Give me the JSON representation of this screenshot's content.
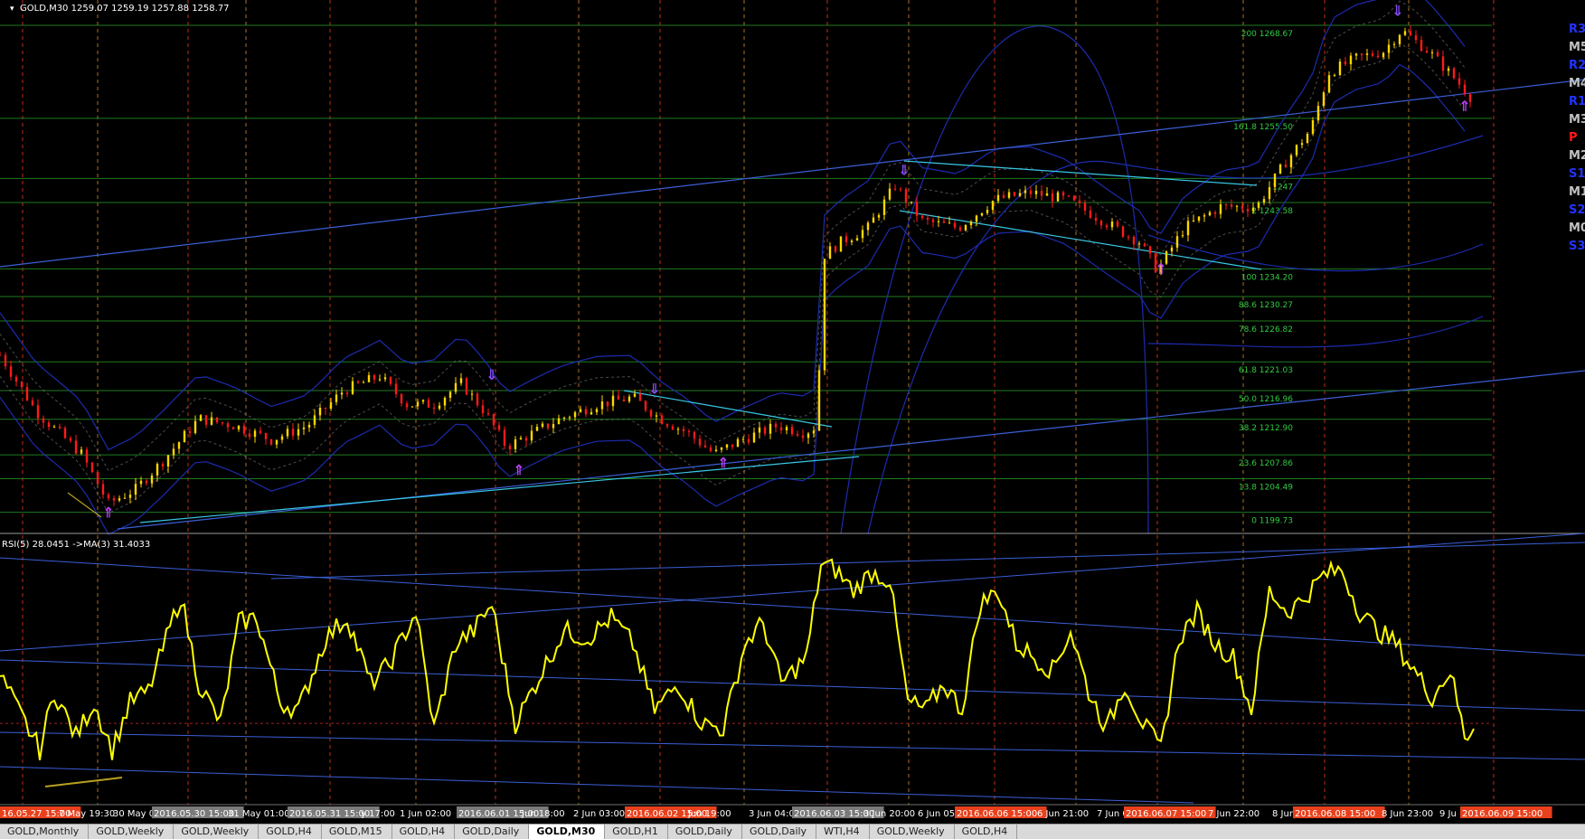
{
  "window": {
    "symbol_header": "GOLD,M30  1259.07 1259.19 1257.88 1258.77",
    "rsi_header": "RSI(5) 28.0451  ->MA(3) 31.4033"
  },
  "colors": {
    "background": "#000000",
    "bull": "#ffd700",
    "bear": "#ff1a1a",
    "rsi_line": "#ffff00",
    "fib_line": "#1f7a1f",
    "fib_text": "#2ecc40",
    "trendline_blue": "#3a5fd6",
    "trendline_cyan": "#38c8e6",
    "bands": "#2030c0",
    "session_sep": "#c03010",
    "day_sep": "#b07020"
  },
  "pivot_labels": [
    {
      "text": "R3",
      "color": "#2233ff"
    },
    {
      "text": "M5",
      "color": "#c0c0c0"
    },
    {
      "text": "R2",
      "color": "#2233ff"
    },
    {
      "text": "M4",
      "color": "#c0c0c0"
    },
    {
      "text": "R1",
      "color": "#2233ff"
    },
    {
      "text": "M3",
      "color": "#c0c0c0"
    },
    {
      "text": "P",
      "color": "#ff1a1a"
    },
    {
      "text": "M2",
      "color": "#c0c0c0"
    },
    {
      "text": "S1",
      "color": "#2233ff"
    },
    {
      "text": "M1",
      "color": "#c0c0c0"
    },
    {
      "text": "S2",
      "color": "#2233ff"
    },
    {
      "text": "M0",
      "color": "#c0c0c0"
    },
    {
      "text": "S3",
      "color": "#2233ff"
    }
  ],
  "chart_data": {
    "type": "line",
    "title": "GOLD,M30",
    "price_axis_range": [
      1197,
      1272
    ],
    "fibonacci_levels": [
      {
        "label": "200 1268.67",
        "price": 1268.67
      },
      {
        "label": "161.8 1255.50",
        "price": 1255.5
      },
      {
        "label": "1247",
        "price": 1247.0
      },
      {
        "label": "2 1243.58",
        "price": 1243.58
      },
      {
        "label": "100 1234.20",
        "price": 1234.2
      },
      {
        "label": "88.6 1230.27",
        "price": 1230.27
      },
      {
        "label": "78.6 1226.82",
        "price": 1226.82
      },
      {
        "label": "61.8 1221.03",
        "price": 1221.03
      },
      {
        "label": "50.0 1216.96",
        "price": 1216.96
      },
      {
        "label": "38.2 1212.90",
        "price": 1212.9
      },
      {
        "label": "23.6 1207.86",
        "price": 1207.86
      },
      {
        "label": "13.8 1204.49",
        "price": 1204.49
      },
      {
        "label": "0 1199.73",
        "price": 1199.73
      }
    ],
    "price_series": [
      {
        "bar": 0,
        "price": 1222
      },
      {
        "bar": 20,
        "price": 1214
      },
      {
        "bar": 45,
        "price": 1208
      },
      {
        "bar": 60,
        "price": 1201
      },
      {
        "bar": 75,
        "price": 1203
      },
      {
        "bar": 90,
        "price": 1207
      },
      {
        "bar": 110,
        "price": 1213
      },
      {
        "bar": 130,
        "price": 1212
      },
      {
        "bar": 150,
        "price": 1210
      },
      {
        "bar": 170,
        "price": 1212
      },
      {
        "bar": 190,
        "price": 1217
      },
      {
        "bar": 210,
        "price": 1219
      },
      {
        "bar": 225,
        "price": 1215
      },
      {
        "bar": 240,
        "price": 1215
      },
      {
        "bar": 255,
        "price": 1218
      },
      {
        "bar": 268,
        "price": 1214
      },
      {
        "bar": 280,
        "price": 1209
      },
      {
        "bar": 295,
        "price": 1211
      },
      {
        "bar": 310,
        "price": 1213
      },
      {
        "bar": 330,
        "price": 1215
      },
      {
        "bar": 350,
        "price": 1216
      },
      {
        "bar": 365,
        "price": 1213
      },
      {
        "bar": 380,
        "price": 1211
      },
      {
        "bar": 395,
        "price": 1208
      },
      {
        "bar": 410,
        "price": 1210
      },
      {
        "bar": 430,
        "price": 1212
      },
      {
        "bar": 445,
        "price": 1211
      },
      {
        "bar": 452,
        "price": 1212
      },
      {
        "bar": 455,
        "price": 1236
      },
      {
        "bar": 465,
        "price": 1238
      },
      {
        "bar": 480,
        "price": 1240
      },
      {
        "bar": 495,
        "price": 1246
      },
      {
        "bar": 510,
        "price": 1241
      },
      {
        "bar": 530,
        "price": 1240
      },
      {
        "bar": 550,
        "price": 1244
      },
      {
        "bar": 570,
        "price": 1245
      },
      {
        "bar": 590,
        "price": 1244
      },
      {
        "bar": 610,
        "price": 1241
      },
      {
        "bar": 630,
        "price": 1238
      },
      {
        "bar": 640,
        "price": 1234
      },
      {
        "bar": 655,
        "price": 1240
      },
      {
        "bar": 675,
        "price": 1243
      },
      {
        "bar": 695,
        "price": 1243
      },
      {
        "bar": 710,
        "price": 1249
      },
      {
        "bar": 725,
        "price": 1254
      },
      {
        "bar": 735,
        "price": 1262
      },
      {
        "bar": 750,
        "price": 1264
      },
      {
        "bar": 765,
        "price": 1265
      },
      {
        "bar": 775,
        "price": 1268
      },
      {
        "bar": 790,
        "price": 1265
      },
      {
        "bar": 805,
        "price": 1261
      },
      {
        "bar": 815,
        "price": 1258
      }
    ],
    "rsi_series": [
      {
        "bar": 0,
        "rsi": 48
      },
      {
        "bar": 10,
        "rsi": 35
      },
      {
        "bar": 22,
        "rsi": 20
      },
      {
        "bar": 30,
        "rsi": 42
      },
      {
        "bar": 42,
        "rsi": 25
      },
      {
        "bar": 52,
        "rsi": 38
      },
      {
        "bar": 62,
        "rsi": 20
      },
      {
        "bar": 72,
        "rsi": 38
      },
      {
        "bar": 82,
        "rsi": 42
      },
      {
        "bar": 92,
        "rsi": 62
      },
      {
        "bar": 100,
        "rsi": 78
      },
      {
        "bar": 110,
        "rsi": 45
      },
      {
        "bar": 122,
        "rsi": 30
      },
      {
        "bar": 132,
        "rsi": 68
      },
      {
        "bar": 142,
        "rsi": 70
      },
      {
        "bar": 155,
        "rsi": 38
      },
      {
        "bar": 165,
        "rsi": 35
      },
      {
        "bar": 180,
        "rsi": 62
      },
      {
        "bar": 192,
        "rsi": 70
      },
      {
        "bar": 205,
        "rsi": 45
      },
      {
        "bar": 215,
        "rsi": 52
      },
      {
        "bar": 230,
        "rsi": 72
      },
      {
        "bar": 240,
        "rsi": 28
      },
      {
        "bar": 252,
        "rsi": 60
      },
      {
        "bar": 262,
        "rsi": 65
      },
      {
        "bar": 272,
        "rsi": 75
      },
      {
        "bar": 285,
        "rsi": 30
      },
      {
        "bar": 300,
        "rsi": 50
      },
      {
        "bar": 312,
        "rsi": 65
      },
      {
        "bar": 325,
        "rsi": 62
      },
      {
        "bar": 338,
        "rsi": 70
      },
      {
        "bar": 350,
        "rsi": 60
      },
      {
        "bar": 362,
        "rsi": 35
      },
      {
        "bar": 375,
        "rsi": 45
      },
      {
        "bar": 388,
        "rsi": 30
      },
      {
        "bar": 400,
        "rsi": 28
      },
      {
        "bar": 412,
        "rsi": 60
      },
      {
        "bar": 422,
        "rsi": 68
      },
      {
        "bar": 432,
        "rsi": 45
      },
      {
        "bar": 446,
        "rsi": 55
      },
      {
        "bar": 454,
        "rsi": 90
      },
      {
        "bar": 462,
        "rsi": 88
      },
      {
        "bar": 472,
        "rsi": 80
      },
      {
        "bar": 482,
        "rsi": 87
      },
      {
        "bar": 492,
        "rsi": 84
      },
      {
        "bar": 502,
        "rsi": 38
      },
      {
        "bar": 512,
        "rsi": 35
      },
      {
        "bar": 522,
        "rsi": 45
      },
      {
        "bar": 532,
        "rsi": 35
      },
      {
        "bar": 542,
        "rsi": 75
      },
      {
        "bar": 552,
        "rsi": 80
      },
      {
        "bar": 562,
        "rsi": 60
      },
      {
        "bar": 572,
        "rsi": 55
      },
      {
        "bar": 582,
        "rsi": 50
      },
      {
        "bar": 592,
        "rsi": 65
      },
      {
        "bar": 602,
        "rsi": 42
      },
      {
        "bar": 612,
        "rsi": 28
      },
      {
        "bar": 622,
        "rsi": 45
      },
      {
        "bar": 632,
        "rsi": 30
      },
      {
        "bar": 642,
        "rsi": 20
      },
      {
        "bar": 652,
        "rsi": 62
      },
      {
        "bar": 662,
        "rsi": 72
      },
      {
        "bar": 672,
        "rsi": 60
      },
      {
        "bar": 682,
        "rsi": 55
      },
      {
        "bar": 692,
        "rsi": 35
      },
      {
        "bar": 702,
        "rsi": 80
      },
      {
        "bar": 712,
        "rsi": 72
      },
      {
        "bar": 722,
        "rsi": 78
      },
      {
        "bar": 732,
        "rsi": 86
      },
      {
        "bar": 742,
        "rsi": 88
      },
      {
        "bar": 752,
        "rsi": 72
      },
      {
        "bar": 762,
        "rsi": 65
      },
      {
        "bar": 772,
        "rsi": 60
      },
      {
        "bar": 782,
        "rsi": 50
      },
      {
        "bar": 792,
        "rsi": 40
      },
      {
        "bar": 802,
        "rsi": 50
      },
      {
        "bar": 810,
        "rsi": 25
      },
      {
        "bar": 815,
        "rsi": 28
      }
    ],
    "annotations": [
      {
        "type": "arrow-down",
        "bar": 500,
        "price": 1247.5
      },
      {
        "type": "arrow-up",
        "bar": 642,
        "price": 1233.5
      },
      {
        "type": "arrow-down",
        "bar": 773,
        "price": 1270
      },
      {
        "type": "arrow-up",
        "bar": 810,
        "price": 1256.5
      },
      {
        "type": "arrow-down",
        "bar": 272,
        "price": 1218.5
      },
      {
        "type": "arrow-up",
        "bar": 287,
        "price": 1205
      },
      {
        "type": "arrow-down",
        "bar": 362,
        "price": 1216.5
      },
      {
        "type": "arrow-up",
        "bar": 400,
        "price": 1206
      },
      {
        "type": "arrow-up",
        "bar": 60,
        "price": 1199
      }
    ],
    "time_labels": [
      {
        "text": "16.05.27 15:00",
        "highlight": "red"
      },
      {
        "text": "7 May 19:30",
        "highlight": "none"
      },
      {
        "text": "30 May 04",
        "highlight": "none"
      },
      {
        "text": "2016.05.30 15:00",
        "highlight": "grey"
      },
      {
        "text": "31 May 01:00",
        "highlight": "none"
      },
      {
        "text": "31",
        "highlight": "none"
      },
      {
        "text": "2016.05.31 15:00",
        "highlight": "grey"
      },
      {
        "text": "y 17:00",
        "highlight": "none"
      },
      {
        "text": "1 Jun 02:00",
        "highlight": "none"
      },
      {
        "text": "2016.06.01 15:00",
        "highlight": "grey"
      },
      {
        "text": "Jun 18:00",
        "highlight": "none"
      },
      {
        "text": "2 Jun 03:00",
        "highlight": "none"
      },
      {
        "text": "2016.06.02 15:00",
        "highlight": "red"
      },
      {
        "text": "Jun 19:00",
        "highlight": "none"
      },
      {
        "text": "3 Jun 04:00",
        "highlight": "none"
      },
      {
        "text": "2016.06.03 15:00",
        "highlight": "grey"
      },
      {
        "text": "3 Jun 20:00",
        "highlight": "none"
      },
      {
        "text": "6 Jun 05:0",
        "highlight": "none"
      },
      {
        "text": "2016.06.06 15:00",
        "highlight": "red"
      },
      {
        "text": "6 Jun 21:00",
        "highlight": "none"
      },
      {
        "text": "7 Jun 0",
        "highlight": "none"
      },
      {
        "text": "2016.06.07 15:00",
        "highlight": "red"
      },
      {
        "text": "7 Jun 22:00",
        "highlight": "none"
      },
      {
        "text": "8 Jun",
        "highlight": "none"
      },
      {
        "text": "2016.06.08 15:00",
        "highlight": "red"
      },
      {
        "text": "8 Jun 23:00",
        "highlight": "none"
      },
      {
        "text": "9 Ju",
        "highlight": "none"
      },
      {
        "text": "2016.06.09 15:00",
        "highlight": "red"
      }
    ]
  },
  "tabs": [
    {
      "label": "GOLD,Monthly",
      "active": false
    },
    {
      "label": "GOLD,Weekly",
      "active": false
    },
    {
      "label": "GOLD,Weekly",
      "active": false
    },
    {
      "label": "GOLD,H4",
      "active": false
    },
    {
      "label": "GOLD,M15",
      "active": false
    },
    {
      "label": "GOLD,H4",
      "active": false
    },
    {
      "label": "GOLD,Daily",
      "active": false
    },
    {
      "label": "GOLD,M30",
      "active": true
    },
    {
      "label": "GOLD,H1",
      "active": false
    },
    {
      "label": "GOLD,Daily",
      "active": false
    },
    {
      "label": "GOLD,Daily",
      "active": false
    },
    {
      "label": "WTI,H4",
      "active": false
    },
    {
      "label": "GOLD,Weekly",
      "active": false
    },
    {
      "label": "GOLD,H4",
      "active": false
    }
  ]
}
